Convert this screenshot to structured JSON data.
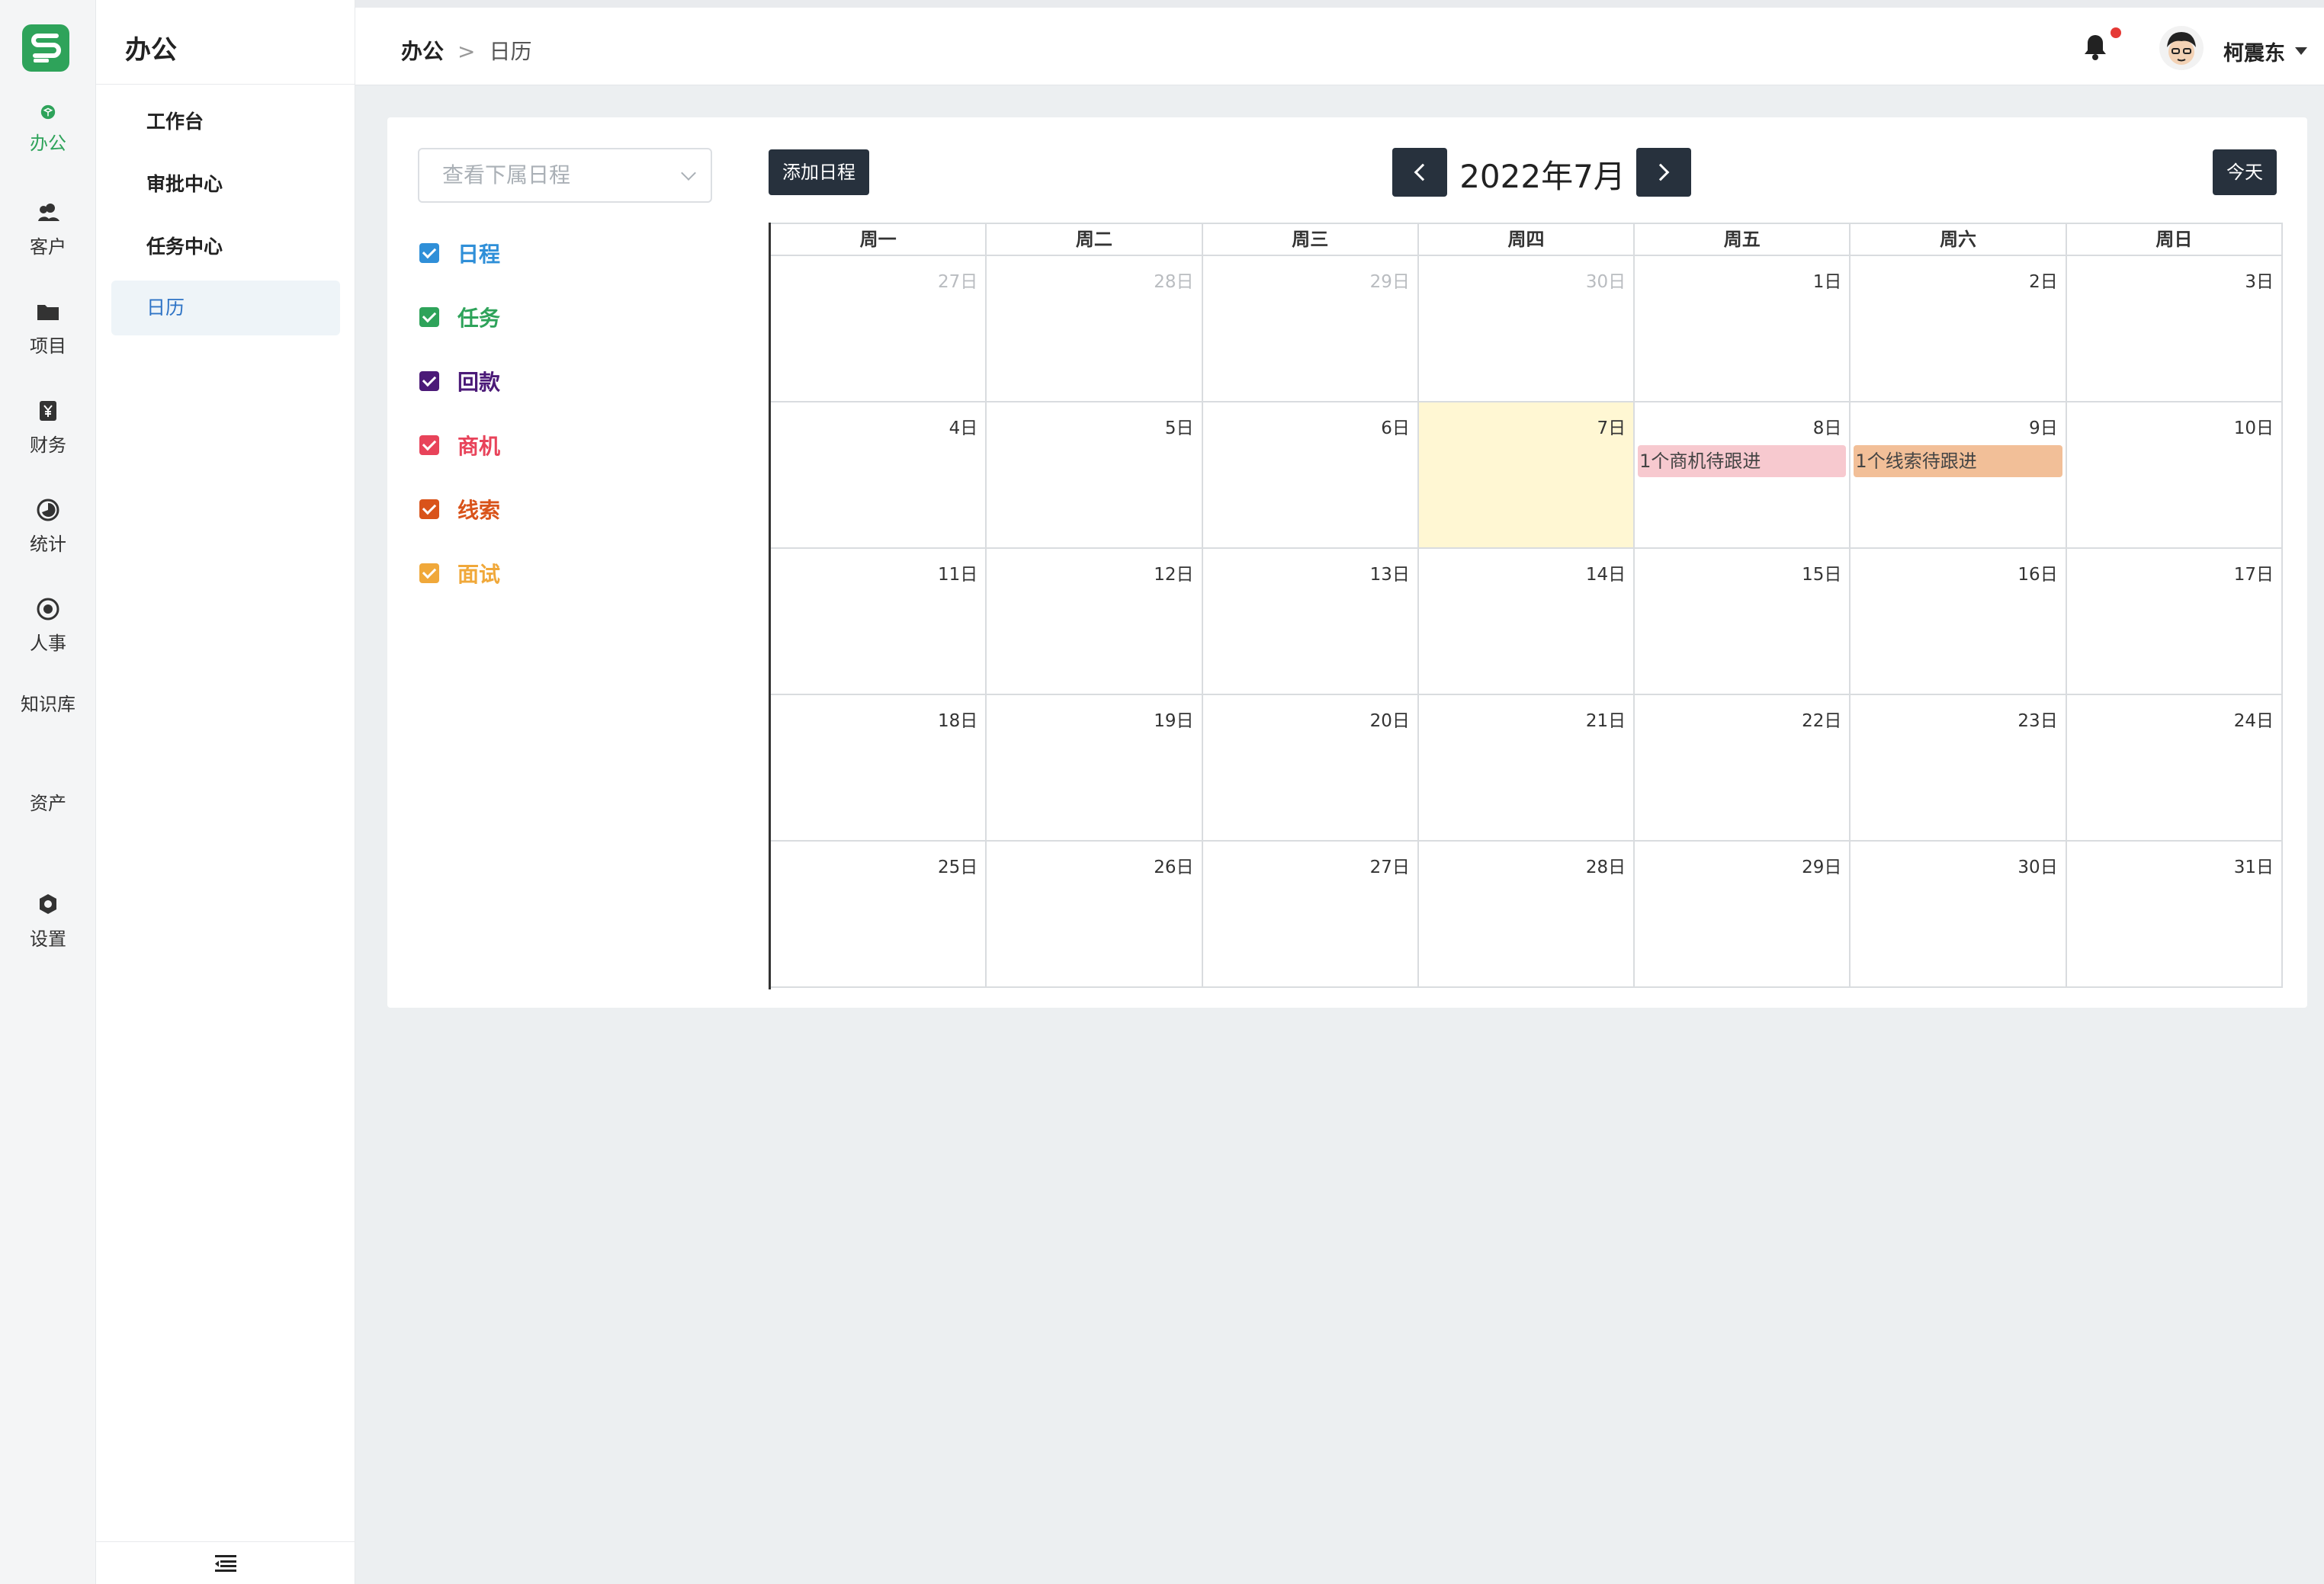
{
  "rail": {
    "items": [
      {
        "label": "办公",
        "icon": "cube-icon",
        "active": true
      },
      {
        "label": "客户",
        "icon": "users-icon"
      },
      {
        "label": "项目",
        "icon": "folder-icon"
      },
      {
        "label": "财务",
        "icon": "yen-icon"
      },
      {
        "label": "统计",
        "icon": "pie-icon"
      },
      {
        "label": "人事",
        "icon": "target-icon"
      },
      {
        "label": "知识库",
        "icon": ""
      },
      {
        "label": "资产",
        "icon": ""
      },
      {
        "label": "设置",
        "icon": "gear-icon"
      }
    ]
  },
  "submenu": {
    "title": "办公",
    "items": [
      {
        "label": "工作台"
      },
      {
        "label": "审批中心"
      },
      {
        "label": "任务中心"
      },
      {
        "label": "日历",
        "active": true
      }
    ]
  },
  "header": {
    "breadcrumb": [
      "办公",
      ">",
      "日历"
    ],
    "username": "柯震东"
  },
  "calendar": {
    "select_placeholder": "查看下属日程",
    "legend": [
      {
        "label": "日程",
        "color": "#2f8fd8"
      },
      {
        "label": "任务",
        "color": "#2ea35a"
      },
      {
        "label": "回款",
        "color": "#4b1a78"
      },
      {
        "label": "商机",
        "color": "#e8435a"
      },
      {
        "label": "线索",
        "color": "#d9531a"
      },
      {
        "label": "面试",
        "color": "#f0a83a"
      }
    ],
    "add_button": "添加日程",
    "month_title": "2022年7月",
    "today_button": "今天",
    "weekdays": [
      "周一",
      "周二",
      "周三",
      "周四",
      "周五",
      "周六",
      "周日"
    ],
    "days": [
      {
        "num": "27日",
        "other": true
      },
      {
        "num": "28日",
        "other": true
      },
      {
        "num": "29日",
        "other": true
      },
      {
        "num": "30日",
        "other": true
      },
      {
        "num": "1日"
      },
      {
        "num": "2日"
      },
      {
        "num": "3日"
      },
      {
        "num": "4日"
      },
      {
        "num": "5日"
      },
      {
        "num": "6日"
      },
      {
        "num": "7日",
        "today": true
      },
      {
        "num": "8日",
        "event": "1个商机待跟进",
        "event_color": "#f7c9cf"
      },
      {
        "num": "9日",
        "event": "1个线索待跟进",
        "event_color": "#f2bf98"
      },
      {
        "num": "10日"
      },
      {
        "num": "11日"
      },
      {
        "num": "12日"
      },
      {
        "num": "13日"
      },
      {
        "num": "14日"
      },
      {
        "num": "15日"
      },
      {
        "num": "16日"
      },
      {
        "num": "17日"
      },
      {
        "num": "18日"
      },
      {
        "num": "19日"
      },
      {
        "num": "20日"
      },
      {
        "num": "21日"
      },
      {
        "num": "22日"
      },
      {
        "num": "23日"
      },
      {
        "num": "24日"
      },
      {
        "num": "25日"
      },
      {
        "num": "26日"
      },
      {
        "num": "27日"
      },
      {
        "num": "28日"
      },
      {
        "num": "29日"
      },
      {
        "num": "30日"
      },
      {
        "num": "31日"
      }
    ]
  },
  "colors": {
    "brand": "#2ea35a",
    "dark_button": "#27313d",
    "today_bg": "#fff7d3",
    "active_link": "#2f74c6"
  }
}
